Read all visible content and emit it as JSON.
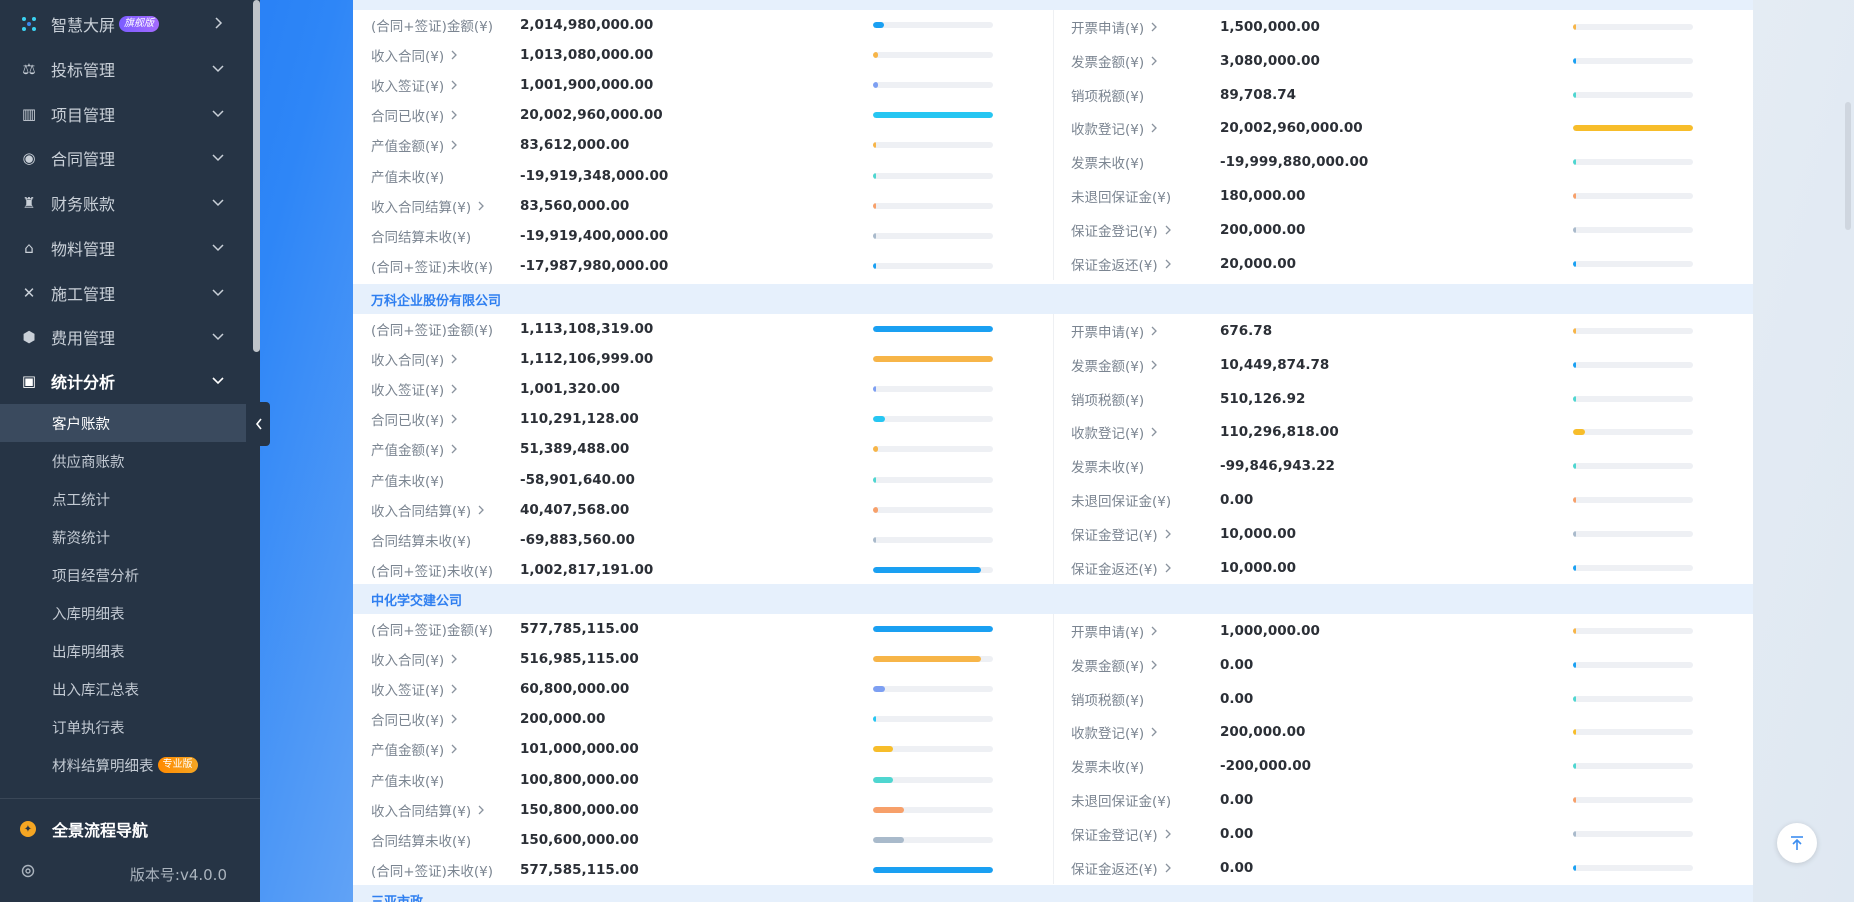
{
  "sidebar": {
    "top_item": {
      "label": "智慧大屏",
      "badge": "旗舰版"
    },
    "menus": [
      {
        "label": "投标管理",
        "icon": "bid-icon"
      },
      {
        "label": "项目管理",
        "icon": "building-icon"
      },
      {
        "label": "合同管理",
        "icon": "contract-icon"
      },
      {
        "label": "财务账款",
        "icon": "money-bag-icon"
      },
      {
        "label": "物料管理",
        "icon": "warehouse-icon"
      },
      {
        "label": "施工管理",
        "icon": "tools-icon"
      },
      {
        "label": "费用管理",
        "icon": "shield-icon"
      }
    ],
    "active_menu": {
      "label": "统计分析",
      "icon": "chart-box-icon"
    },
    "sub_items": [
      {
        "label": "客户账款",
        "active": true
      },
      {
        "label": "供应商账款"
      },
      {
        "label": "点工统计"
      },
      {
        "label": "薪资统计"
      },
      {
        "label": "项目经营分析"
      },
      {
        "label": "入库明细表"
      },
      {
        "label": "出库明细表"
      },
      {
        "label": "出入库汇总表"
      },
      {
        "label": "订单执行表"
      },
      {
        "label": "材料结算明细表",
        "badge": "专业版"
      }
    ],
    "flow_nav": "全景流程导航",
    "version": "版本号:v4.0.0"
  },
  "colors": {
    "sidebar_bg": "#263445",
    "section_header_bg": "#e6f0fc",
    "section_header_text": "#2f7ff0",
    "blue": "#1aa0f2",
    "cyan": "#26c6f2",
    "orange": "#f7b548",
    "periwinkle": "#7d9ff2",
    "yellow": "#f7bd2a",
    "teal": "#4fd6d0",
    "salmon": "#f7a06a",
    "grayblue": "#a9bacb"
  },
  "sections": [
    {
      "name": "",
      "left": [
        {
          "label": "(合同+签证)金额(¥)",
          "value": "2,014,980,000.00",
          "arrow": false,
          "pct": 0.09,
          "color": "#1aa0f2"
        },
        {
          "label": "收入合同(¥)",
          "value": "1,013,080,000.00",
          "arrow": true,
          "pct": 0.04,
          "color": "#f7b548"
        },
        {
          "label": "收入签证(¥)",
          "value": "1,001,900,000.00",
          "arrow": true,
          "pct": 0.04,
          "color": "#7d9ff2"
        },
        {
          "label": "合同已收(¥)",
          "value": "20,002,960,000.00",
          "arrow": true,
          "pct": 1.0,
          "color": "#26c6f2"
        },
        {
          "label": "产值金额(¥)",
          "value": "83,612,000.00",
          "arrow": true,
          "pct": 0.02,
          "color": "#f7b548"
        },
        {
          "label": "产值未收(¥)",
          "value": "-19,919,348,000.00",
          "arrow": false,
          "pct": 0.02,
          "color": "#4fd6d0"
        },
        {
          "label": "收入合同结算(¥)",
          "value": "83,560,000.00",
          "arrow": true,
          "pct": 0.02,
          "color": "#f7a06a"
        },
        {
          "label": "合同结算未收(¥)",
          "value": "-19,919,400,000.00",
          "arrow": false,
          "pct": 0.02,
          "color": "#a9bacb"
        },
        {
          "label": "(合同+签证)未收(¥)",
          "value": "-17,987,980,000.00",
          "arrow": false,
          "pct": 0.02,
          "color": "#1aa0f2"
        }
      ],
      "right": [
        {
          "label": "开票申请(¥)",
          "value": "1,500,000.00",
          "arrow": true,
          "pct": 0.02,
          "color": "#f7b548"
        },
        {
          "label": "发票金额(¥)",
          "value": "3,080,000.00",
          "arrow": true,
          "pct": 0.02,
          "color": "#1aa0f2"
        },
        {
          "label": "销项税额(¥)",
          "value": "89,708.74",
          "arrow": false,
          "pct": 0.02,
          "color": "#4fd6d0"
        },
        {
          "label": "收款登记(¥)",
          "value": "20,002,960,000.00",
          "arrow": true,
          "pct": 1.0,
          "color": "#f7bd2a"
        },
        {
          "label": "发票未收(¥)",
          "value": "-19,999,880,000.00",
          "arrow": false,
          "pct": 0.02,
          "color": "#4fd6d0"
        },
        {
          "label": "未退回保证金(¥)",
          "value": "180,000.00",
          "arrow": false,
          "pct": 0.02,
          "color": "#f7a06a"
        },
        {
          "label": "保证金登记(¥)",
          "value": "200,000.00",
          "arrow": true,
          "pct": 0.02,
          "color": "#a9bacb"
        },
        {
          "label": "保证金返还(¥)",
          "value": "20,000.00",
          "arrow": true,
          "pct": 0.02,
          "color": "#1aa0f2"
        }
      ]
    },
    {
      "name": "万科企业股份有限公司",
      "left": [
        {
          "label": "(合同+签证)金额(¥)",
          "value": "1,113,108,319.00",
          "arrow": false,
          "pct": 1.0,
          "color": "#1aa0f2"
        },
        {
          "label": "收入合同(¥)",
          "value": "1,112,106,999.00",
          "arrow": true,
          "pct": 1.0,
          "color": "#f7b548"
        },
        {
          "label": "收入签证(¥)",
          "value": "1,001,320.00",
          "arrow": true,
          "pct": 0.02,
          "color": "#7d9ff2"
        },
        {
          "label": "合同已收(¥)",
          "value": "110,291,128.00",
          "arrow": true,
          "pct": 0.1,
          "color": "#26c6f2"
        },
        {
          "label": "产值金额(¥)",
          "value": "51,389,488.00",
          "arrow": true,
          "pct": 0.04,
          "color": "#f7b548"
        },
        {
          "label": "产值未收(¥)",
          "value": "-58,901,640.00",
          "arrow": false,
          "pct": 0.02,
          "color": "#4fd6d0"
        },
        {
          "label": "收入合同结算(¥)",
          "value": "40,407,568.00",
          "arrow": true,
          "pct": 0.04,
          "color": "#f7a06a"
        },
        {
          "label": "合同结算未收(¥)",
          "value": "-69,883,560.00",
          "arrow": false,
          "pct": 0.02,
          "color": "#a9bacb"
        },
        {
          "label": "(合同+签证)未收(¥)",
          "value": "1,002,817,191.00",
          "arrow": false,
          "pct": 0.9,
          "color": "#1aa0f2"
        }
      ],
      "right": [
        {
          "label": "开票申请(¥)",
          "value": "676.78",
          "arrow": true,
          "pct": 0.02,
          "color": "#f7b548"
        },
        {
          "label": "发票金额(¥)",
          "value": "10,449,874.78",
          "arrow": true,
          "pct": 0.02,
          "color": "#1aa0f2"
        },
        {
          "label": "销项税额(¥)",
          "value": "510,126.92",
          "arrow": false,
          "pct": 0.02,
          "color": "#4fd6d0"
        },
        {
          "label": "收款登记(¥)",
          "value": "110,296,818.00",
          "arrow": true,
          "pct": 0.1,
          "color": "#f7bd2a"
        },
        {
          "label": "发票未收(¥)",
          "value": "-99,846,943.22",
          "arrow": false,
          "pct": 0.02,
          "color": "#4fd6d0"
        },
        {
          "label": "未退回保证金(¥)",
          "value": "0.00",
          "arrow": false,
          "pct": 0.02,
          "color": "#f7a06a"
        },
        {
          "label": "保证金登记(¥)",
          "value": "10,000.00",
          "arrow": true,
          "pct": 0.02,
          "color": "#a9bacb"
        },
        {
          "label": "保证金返还(¥)",
          "value": "10,000.00",
          "arrow": true,
          "pct": 0.02,
          "color": "#1aa0f2"
        }
      ]
    },
    {
      "name": "中化学交建公司",
      "left": [
        {
          "label": "(合同+签证)金额(¥)",
          "value": "577,785,115.00",
          "arrow": false,
          "pct": 1.0,
          "color": "#1aa0f2"
        },
        {
          "label": "收入合同(¥)",
          "value": "516,985,115.00",
          "arrow": true,
          "pct": 0.9,
          "color": "#f7b548"
        },
        {
          "label": "收入签证(¥)",
          "value": "60,800,000.00",
          "arrow": true,
          "pct": 0.1,
          "color": "#7d9ff2"
        },
        {
          "label": "合同已收(¥)",
          "value": "200,000.00",
          "arrow": true,
          "pct": 0.02,
          "color": "#26c6f2"
        },
        {
          "label": "产值金额(¥)",
          "value": "101,000,000.00",
          "arrow": true,
          "pct": 0.17,
          "color": "#f7bd2a"
        },
        {
          "label": "产值未收(¥)",
          "value": "100,800,000.00",
          "arrow": false,
          "pct": 0.17,
          "color": "#4fd6d0"
        },
        {
          "label": "收入合同结算(¥)",
          "value": "150,800,000.00",
          "arrow": true,
          "pct": 0.26,
          "color": "#f7a06a"
        },
        {
          "label": "合同结算未收(¥)",
          "value": "150,600,000.00",
          "arrow": false,
          "pct": 0.26,
          "color": "#a9bacb"
        },
        {
          "label": "(合同+签证)未收(¥)",
          "value": "577,585,115.00",
          "arrow": false,
          "pct": 1.0,
          "color": "#1aa0f2"
        }
      ],
      "right": [
        {
          "label": "开票申请(¥)",
          "value": "1,000,000.00",
          "arrow": true,
          "pct": 0.02,
          "color": "#f7b548"
        },
        {
          "label": "发票金额(¥)",
          "value": "0.00",
          "arrow": true,
          "pct": 0.02,
          "color": "#1aa0f2"
        },
        {
          "label": "销项税额(¥)",
          "value": "0.00",
          "arrow": false,
          "pct": 0.02,
          "color": "#4fd6d0"
        },
        {
          "label": "收款登记(¥)",
          "value": "200,000.00",
          "arrow": true,
          "pct": 0.02,
          "color": "#f7bd2a"
        },
        {
          "label": "发票未收(¥)",
          "value": "-200,000.00",
          "arrow": false,
          "pct": 0.02,
          "color": "#4fd6d0"
        },
        {
          "label": "未退回保证金(¥)",
          "value": "0.00",
          "arrow": false,
          "pct": 0.02,
          "color": "#f7a06a"
        },
        {
          "label": "保证金登记(¥)",
          "value": "0.00",
          "arrow": true,
          "pct": 0.02,
          "color": "#a9bacb"
        },
        {
          "label": "保证金返还(¥)",
          "value": "0.00",
          "arrow": true,
          "pct": 0.02,
          "color": "#1aa0f2"
        }
      ]
    },
    {
      "name": "三亚市政"
    }
  ]
}
